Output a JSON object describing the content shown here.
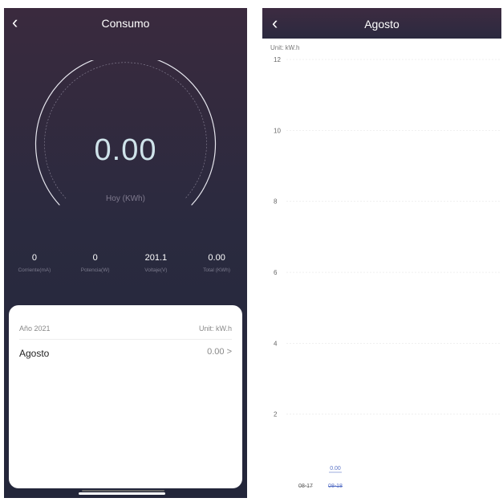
{
  "left": {
    "header": {
      "back_icon": "chevron-left-icon",
      "title": "Consumo"
    },
    "gauge": {
      "value": "0.00",
      "unit_label": "Hoy (KWh)"
    },
    "stats": [
      {
        "value": "0",
        "label": "Corriente(mA)"
      },
      {
        "value": "0",
        "label": "Potencia(W)"
      },
      {
        "value": "201.1",
        "label": "Voltaje(V)"
      },
      {
        "value": "0.00",
        "label": "Total (KWh)"
      }
    ],
    "card": {
      "year": "Año 2021",
      "unit": "Unit: kW.h",
      "month": "Agosto",
      "month_value": "0.00 >"
    }
  },
  "right": {
    "header": {
      "back_icon": "chevron-left-icon",
      "title": "Agosto"
    }
  },
  "colors": {
    "header_bg": "#3a2a3e",
    "gauge_value": "#cfe3ea",
    "selected_date": "#5b74c7"
  },
  "chart_data": {
    "type": "bar",
    "unit_label": "Unit: kW.h",
    "categories": [
      "08-17",
      "08-18"
    ],
    "values": [
      0,
      0
    ],
    "value_labels": [
      "",
      "0.00"
    ],
    "selected_index": 1,
    "y_ticks": [
      2,
      4,
      6,
      8,
      10,
      12
    ],
    "ylim": [
      0,
      12.5
    ],
    "grid": true
  }
}
